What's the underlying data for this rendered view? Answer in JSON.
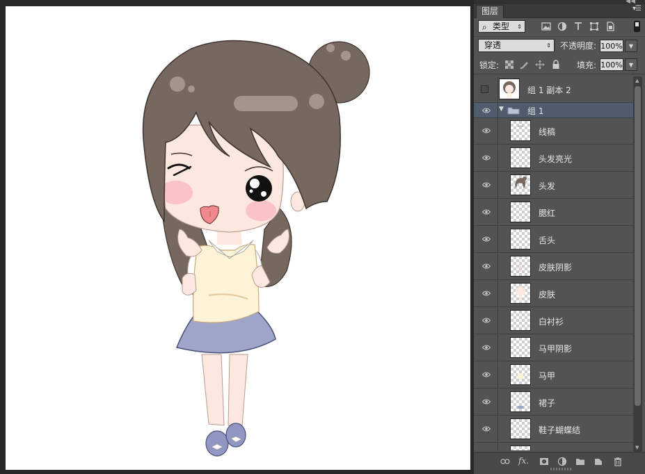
{
  "panel": {
    "tab_label": "图层",
    "menu_icon": "panel-menu-icon",
    "filter": {
      "select_label": "类型",
      "icons": [
        "image-filter-icon",
        "adjustment-filter-icon",
        "type-filter-icon",
        "shape-filter-icon",
        "smart-object-filter-icon"
      ]
    },
    "blend_mode": "穿透",
    "opacity_label": "不透明度:",
    "opacity_value": "100%",
    "lock_label": "锁定:",
    "lock_icons": [
      "lock-transparent-icon",
      "lock-image-icon",
      "lock-position-icon",
      "lock-all-icon"
    ],
    "fill_label": "填充:",
    "fill_value": "100%"
  },
  "layers": [
    {
      "name": "组 1 副本 2",
      "visible": false,
      "type": "group-collapsed",
      "thumb": "character"
    },
    {
      "name": "组 1",
      "visible": true,
      "type": "group-open",
      "selected": true
    },
    {
      "name": "线稿",
      "visible": true,
      "thumb": "lineart"
    },
    {
      "name": "头发亮光",
      "visible": true,
      "thumb": "empty"
    },
    {
      "name": "头发",
      "visible": true,
      "thumb": "hair"
    },
    {
      "name": "腮红",
      "visible": true,
      "thumb": "empty"
    },
    {
      "name": "舌头",
      "visible": true,
      "thumb": "empty"
    },
    {
      "name": "皮肤阴影",
      "visible": true,
      "thumb": "skin-shadow"
    },
    {
      "name": "皮肤",
      "visible": true,
      "thumb": "skin"
    },
    {
      "name": "白衬衫",
      "visible": true,
      "thumb": "empty"
    },
    {
      "name": "马甲阴影",
      "visible": true,
      "thumb": "empty"
    },
    {
      "name": "马甲",
      "visible": true,
      "thumb": "vest"
    },
    {
      "name": "裙子",
      "visible": true,
      "thumb": "skirt"
    },
    {
      "name": "鞋子蝴蝶结",
      "visible": true,
      "thumb": "empty"
    }
  ],
  "bottom_icons": [
    "link-layers-icon",
    "fx-icon",
    "add-mask-icon",
    "adjustment-layer-icon",
    "new-group-icon",
    "new-layer-icon",
    "delete-layer-icon"
  ],
  "colors": {
    "hair": "#76675f",
    "skin": "#fde8e0",
    "vest": "#fdf3d6",
    "skirt": "#9fa5c8",
    "panel": "#535353",
    "selected_row": "#4f5c6e"
  }
}
